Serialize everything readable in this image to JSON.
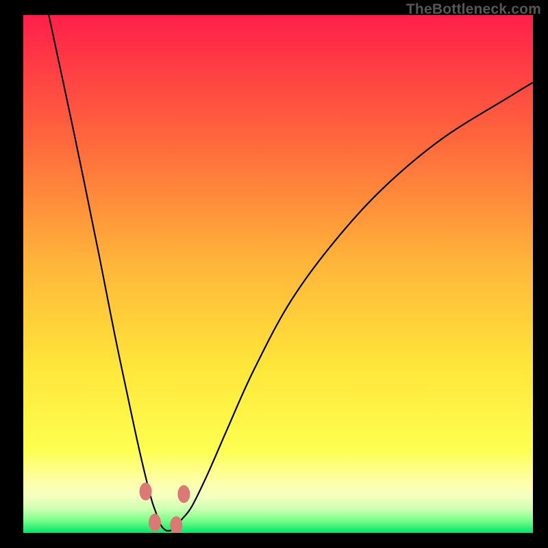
{
  "watermark": "TheBottleneck.com",
  "colors": {
    "black": "#000000",
    "marker": "#db7a74",
    "gradient_top": "#ff1f4a",
    "gradient_mid1": "#ff8f3a",
    "gradient_mid2": "#ffe63a",
    "gradient_yellow_pale": "#ffff9f",
    "gradient_green_pale": "#c9ffb0",
    "gradient_green": "#00e66a"
  },
  "chart_data": {
    "type": "line",
    "title": "",
    "xlabel": "",
    "ylabel": "",
    "xlim": [
      0,
      100
    ],
    "ylim": [
      0,
      100
    ],
    "note": "V-shaped bottleneck curve. Minimum (best match) near x≈28 at y≈0; curve rises steeply on both sides toward red. Background heat gradient: green at bottom (no bottleneck) → yellow → orange → red at top (severe bottleneck).",
    "series": [
      {
        "name": "bottleneck-curve",
        "x": [
          5,
          10,
          15,
          18,
          21,
          23,
          25,
          26,
          27,
          28,
          29,
          30,
          31,
          33,
          36,
          40,
          45,
          52,
          60,
          70,
          82,
          95,
          100
        ],
        "y": [
          100,
          77,
          53,
          38,
          24,
          15,
          7,
          4,
          1.5,
          0.5,
          0.5,
          1.2,
          2.5,
          5,
          11,
          20,
          31,
          44,
          55,
          66,
          76,
          84,
          87
        ]
      }
    ],
    "markers": [
      {
        "x": 24.0,
        "y": 8.0
      },
      {
        "x": 25.8,
        "y": 2.0
      },
      {
        "x": 30.0,
        "y": 1.5
      },
      {
        "x": 31.5,
        "y": 7.5
      }
    ]
  }
}
